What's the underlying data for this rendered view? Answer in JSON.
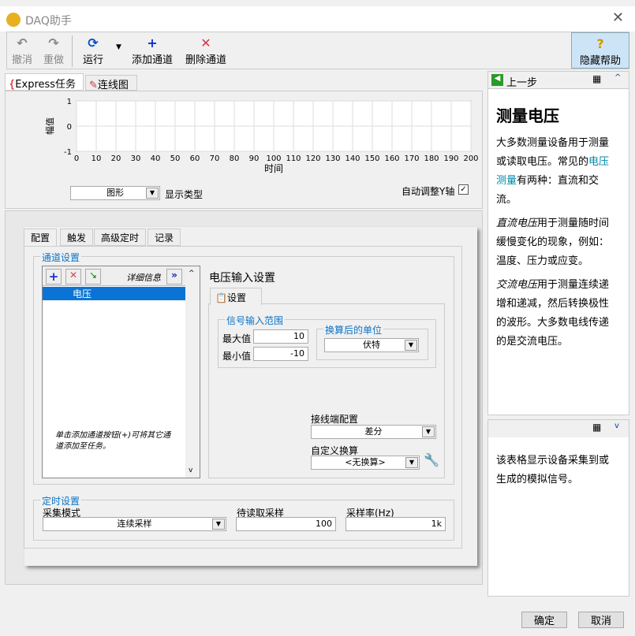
{
  "window": {
    "title": "DAQ助手"
  },
  "toolbar": {
    "undo": "撤消",
    "redo": "重做",
    "run": "运行",
    "add_channel": "添加通道",
    "remove_channel": "删除通道",
    "hide_help": "隐藏帮助"
  },
  "main_tabs": [
    "Express任务",
    "连线图"
  ],
  "chart_data": {
    "type": "line",
    "xlabel": "时间",
    "ylabel": "幅值",
    "xlim": [
      0,
      200
    ],
    "ylim": [
      -1,
      1
    ],
    "x_ticks": [
      "0",
      "10",
      "20",
      "30",
      "40",
      "50",
      "60",
      "70",
      "80",
      "90",
      "100",
      "110",
      "120",
      "130",
      "140",
      "150",
      "160",
      "170",
      "180",
      "190",
      "200"
    ],
    "y_ticks": [
      "1",
      "0",
      "-1"
    ],
    "series": []
  },
  "display": {
    "type_value": "图形",
    "type_label": "显示类型",
    "autoscale_label": "自动调整Y轴"
  },
  "config_tabs": [
    "配置",
    "触发",
    "高级定时",
    "记录"
  ],
  "channel": {
    "group": "通道设置",
    "details": "详细信息",
    "items": [
      "电压"
    ],
    "hint": "单击添加通道按钮(+)可将其它通道添加至任务。"
  },
  "voltage": {
    "title": "电压输入设置",
    "tab": "设置",
    "range_group": "信号输入范围",
    "max_label": "最大值",
    "max": "10",
    "min_label": "最小值",
    "min": "-10",
    "units_group": "换算后的单位",
    "units": "伏特",
    "terminal_label": "接线端配置",
    "terminal": "差分",
    "scale_label": "自定义换算",
    "scale": "<无换算>"
  },
  "timing": {
    "group": "定时设置",
    "mode_label": "采集模式",
    "mode": "连续采样",
    "samples_label": "待读取采样",
    "samples": "100",
    "rate_label": "采样率(Hz)",
    "rate": "1k"
  },
  "help": {
    "back": "上一步",
    "title": "测量电压",
    "p1a": "大多数测量设备用于测量或读取电压。常见的",
    "p1link": "电压测量",
    "p1b": "有两种：直流和交流。",
    "p2a": "直流电压",
    "p2b": "用于测量随时间缓慢变化的现象，例如：温度、压力或应变。",
    "p3a": "交流电压",
    "p3b": "用于测量连续递增和递减，然后转换极性的波形。大多数电线传递的是交流电压。",
    "lower": "该表格显示设备采集到或生成的模拟信号。"
  },
  "buttons": {
    "ok": "确定",
    "cancel": "取消"
  }
}
